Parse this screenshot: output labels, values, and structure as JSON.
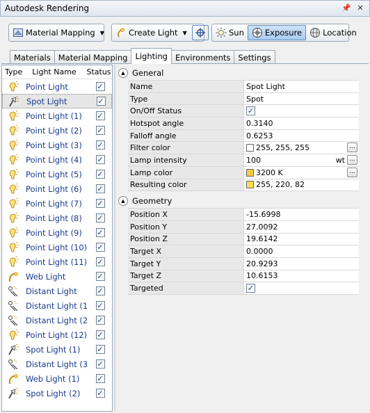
{
  "window": {
    "title": "Autodesk Rendering"
  },
  "toolbar": {
    "material_mapping": "Material Mapping",
    "create_light": "Create Light",
    "sun": "Sun",
    "exposure": "Exposure",
    "location": "Location"
  },
  "tabs": [
    {
      "label": "Materials"
    },
    {
      "label": "Material Mapping"
    },
    {
      "label": "Lighting"
    },
    {
      "label": "Environments"
    },
    {
      "label": "Settings"
    }
  ],
  "list": {
    "col_type": "Type",
    "col_name": "Light Name",
    "col_status": "Status",
    "items": [
      {
        "name": "Point Light",
        "icon": "point-light-icon"
      },
      {
        "name": "Spot Light",
        "icon": "spot-light-icon"
      },
      {
        "name": "Point Light (1)",
        "icon": "point-light-icon"
      },
      {
        "name": "Point Light (2)",
        "icon": "point-light-icon"
      },
      {
        "name": "Point Light (3)",
        "icon": "point-light-icon"
      },
      {
        "name": "Point Light (4)",
        "icon": "point-light-icon"
      },
      {
        "name": "Point Light (5)",
        "icon": "point-light-icon"
      },
      {
        "name": "Point Light (6)",
        "icon": "point-light-icon"
      },
      {
        "name": "Point Light (7)",
        "icon": "point-light-icon"
      },
      {
        "name": "Point Light (8)",
        "icon": "point-light-icon"
      },
      {
        "name": "Point Light (9)",
        "icon": "point-light-icon"
      },
      {
        "name": "Point Light (10)",
        "icon": "point-light-icon"
      },
      {
        "name": "Point Light (11)",
        "icon": "point-light-icon"
      },
      {
        "name": "Web Light",
        "icon": "web-light-icon"
      },
      {
        "name": "Distant Light",
        "icon": "distant-light-icon"
      },
      {
        "name": "Distant Light (1",
        "icon": "distant-light-icon"
      },
      {
        "name": "Distant Light (2",
        "icon": "distant-light-icon"
      },
      {
        "name": "Point Light (12)",
        "icon": "point-light-icon"
      },
      {
        "name": "Spot Light (1)",
        "icon": "spot-light-icon"
      },
      {
        "name": "Distant Light (3",
        "icon": "distant-light-icon"
      },
      {
        "name": "Web Light (1)",
        "icon": "web-light-icon"
      },
      {
        "name": "Spot Light (2)",
        "icon": "spot-light-icon"
      }
    ]
  },
  "general": {
    "title": "General",
    "rows": [
      {
        "name": "Name",
        "value": "Spot Light"
      },
      {
        "name": "Type",
        "value": "Spot"
      },
      {
        "name": "On/Off Status",
        "value": ""
      },
      {
        "name": "Hotspot angle",
        "value": "0.3140"
      },
      {
        "name": "Falloff angle",
        "value": "0.6253"
      },
      {
        "name": "Filter color",
        "value": "255, 255, 255"
      },
      {
        "name": "Lamp intensity",
        "value": "100",
        "unit": "wt"
      },
      {
        "name": "Lamp color",
        "value": "3200 K"
      },
      {
        "name": "Resulting color",
        "value": "255, 220, 82"
      }
    ]
  },
  "geometry": {
    "title": "Geometry",
    "rows": [
      {
        "name": "Position X",
        "value": "-15.6998"
      },
      {
        "name": "Position Y",
        "value": "27.0092"
      },
      {
        "name": "Position Z",
        "value": "19.6142"
      },
      {
        "name": "Target X",
        "value": "0.0000"
      },
      {
        "name": "Target Y",
        "value": "20.9293"
      },
      {
        "name": "Target Z",
        "value": "10.6153"
      },
      {
        "name": "Targeted",
        "value": ""
      }
    ]
  },
  "colors": {
    "filter": "#ffffff",
    "lamp": "#f5c842",
    "resulting": "#ffdc52",
    "link": "#1a3a8f"
  }
}
